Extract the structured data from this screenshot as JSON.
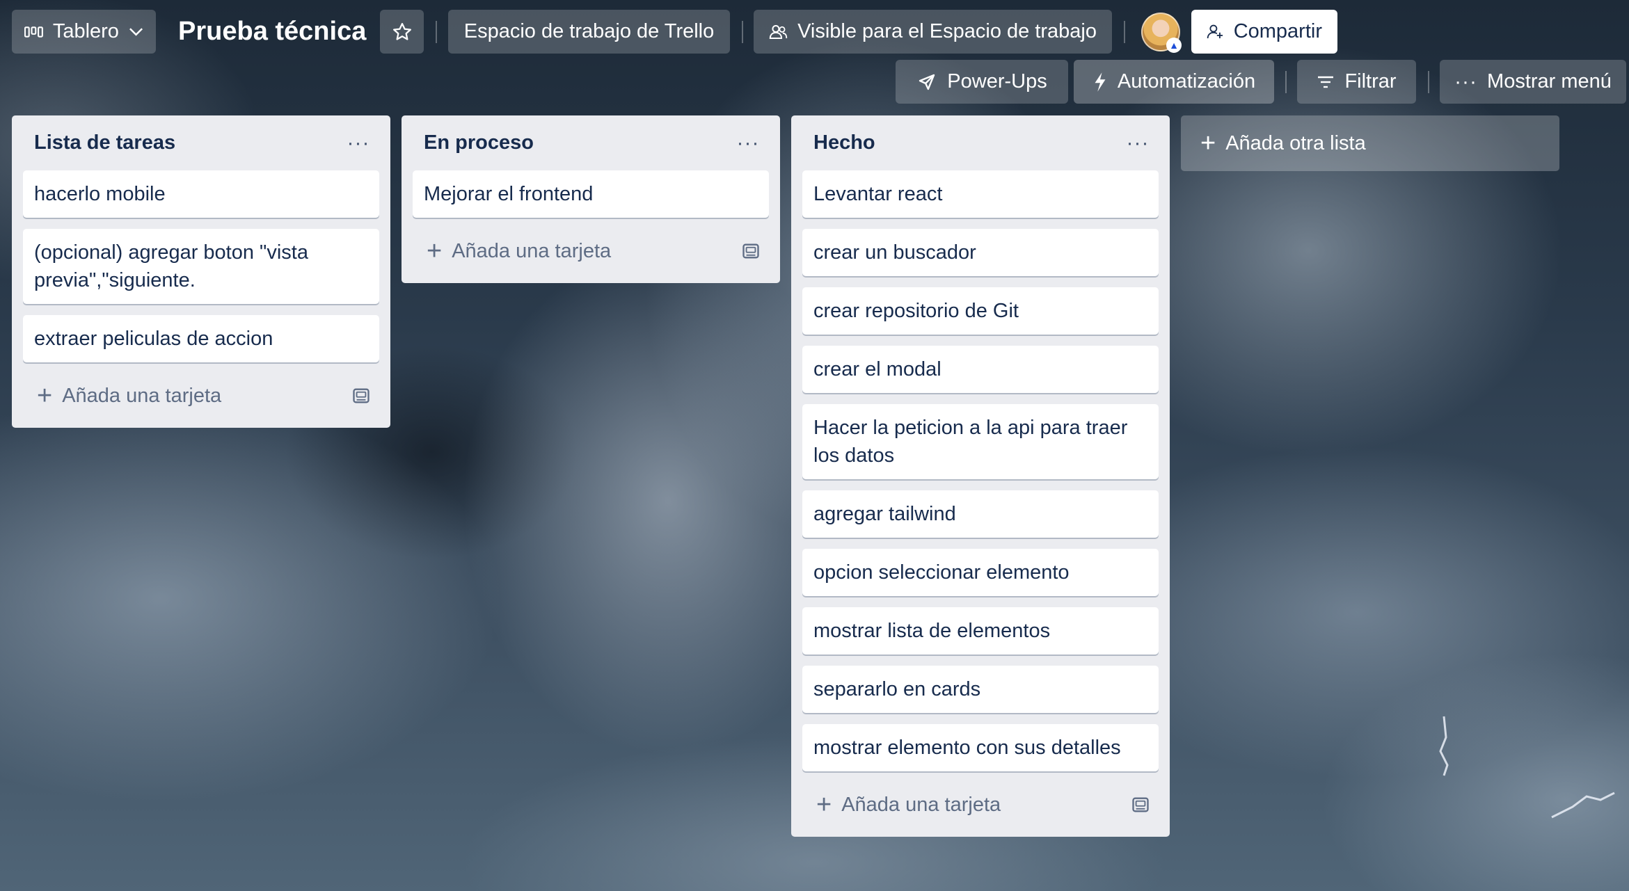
{
  "header": {
    "board_view_label": "Tablero",
    "board_title": "Prueba técnica",
    "workspace_label": "Espacio de trabajo de Trello",
    "visibility_label": "Visible para el Espacio de trabajo",
    "share_label": "Compartir",
    "powerups_label": "Power-Ups",
    "automation_label": "Automatización",
    "filter_label": "Filtrar",
    "menu_label": "Mostrar menú"
  },
  "lists": [
    {
      "title": "Lista de tareas",
      "cards": [
        "hacerlo mobile",
        "(opcional) agregar boton \"vista previa\",\"siguiente.",
        "extraer peliculas de accion"
      ],
      "add_card_label": "Añada una tarjeta"
    },
    {
      "title": "En proceso",
      "cards": [
        "Mejorar el frontend"
      ],
      "add_card_label": "Añada una tarjeta"
    },
    {
      "title": "Hecho",
      "cards": [
        "Levantar react",
        "crear un buscador",
        "crear repositorio de Git",
        "crear el modal",
        "Hacer la peticion a la api para traer los datos",
        "agregar tailwind",
        "opcion seleccionar elemento",
        "mostrar lista de elementos",
        "separarlo en cards",
        "mostrar elemento con sus detalles"
      ],
      "add_card_label": "Añada una tarjeta"
    }
  ],
  "add_list_label": "Añada otra lista",
  "icons": {
    "board_view": "board-icon",
    "chevron": "chevron-down-icon",
    "star": "star-icon",
    "visibility": "workspace-visibility-icon",
    "share": "add-member-icon",
    "powerups": "rocket-icon",
    "automation": "lightning-icon",
    "filter": "filter-icon",
    "menu": "ellipsis-icon",
    "list_menu": "ellipsis-icon",
    "add": "plus-icon",
    "template": "card-template-icon"
  },
  "colors": {
    "list_background": "#ebecf0",
    "card_background": "#ffffff",
    "text_primary": "#172b4d",
    "text_muted": "#5e6c84"
  }
}
